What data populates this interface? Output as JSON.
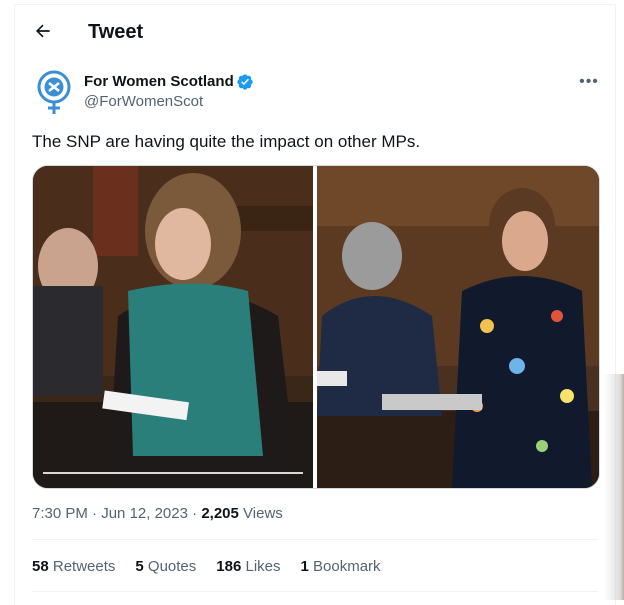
{
  "header": {
    "title": "Tweet"
  },
  "tweet": {
    "author_name": "For Women Scotland",
    "handle": "@ForWomenScot",
    "text": "The SNP are having quite the impact on other MPs.",
    "time": "7:30 PM",
    "date": "Jun 12, 2023",
    "views_count": "2,205",
    "views_label": "Views"
  },
  "stats": {
    "retweets": {
      "count": "58",
      "label": "Retweets"
    },
    "quotes": {
      "count": "5",
      "label": "Quotes"
    },
    "likes": {
      "count": "186",
      "label": "Likes"
    },
    "bookmarks": {
      "count": "1",
      "label": "Bookmark"
    }
  },
  "colors": {
    "verified": "#1d9bf0",
    "secondary_text": "#536471",
    "avatar_blue": "#3b8fd4"
  },
  "icons": [
    "back-arrow-icon",
    "verified-badge-icon",
    "more-options-icon"
  ]
}
